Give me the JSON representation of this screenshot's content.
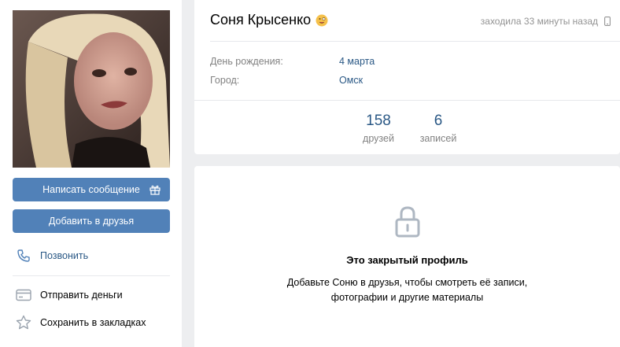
{
  "profile": {
    "name": "Соня Крысенко",
    "online_status": "заходила 33 минуты назад",
    "info": [
      {
        "key": "День рождения:",
        "value": "4 марта"
      },
      {
        "key": "Город:",
        "value": "Омск"
      }
    ],
    "counters": [
      {
        "num": "158",
        "caption": "друзей"
      },
      {
        "num": "6",
        "caption": "записей"
      }
    ]
  },
  "actions": {
    "message_label": "Написать сообщение",
    "add_friend_label": "Добавить в друзья",
    "call_label": "Позвонить",
    "money_label": "Отправить деньги",
    "bookmark_label": "Сохранить в закладках"
  },
  "private": {
    "title": "Это закрытый профиль",
    "text_line1": "Добавьте Соню в друзья, чтобы смотреть её записи,",
    "text_line2": "фотографии и другие материалы"
  },
  "colors": {
    "accent": "#5181b8",
    "link": "#2a5885",
    "muted": "#828282",
    "background": "#edeef0"
  },
  "icons": [
    "gift-icon",
    "phone-icon",
    "card-icon",
    "star-icon",
    "lock-icon",
    "smartphone-icon",
    "emoji-icon"
  ]
}
